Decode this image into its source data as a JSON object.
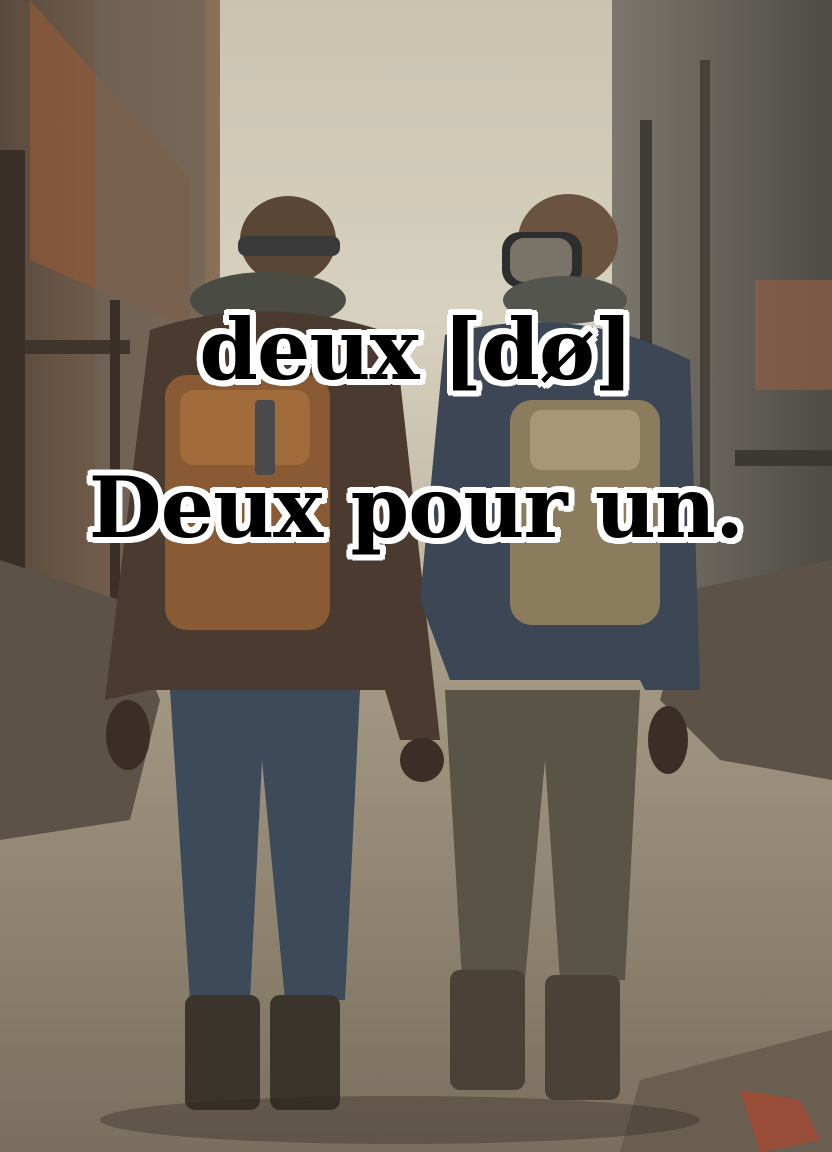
{
  "caption": {
    "word": "deux",
    "ipa": "[dø]",
    "sentence": "Deux pour un."
  },
  "colors": {
    "sky": "#cfc9b8",
    "ground": "#9a8f7e",
    "text": "#000000",
    "text_outline": "#ffffff"
  }
}
